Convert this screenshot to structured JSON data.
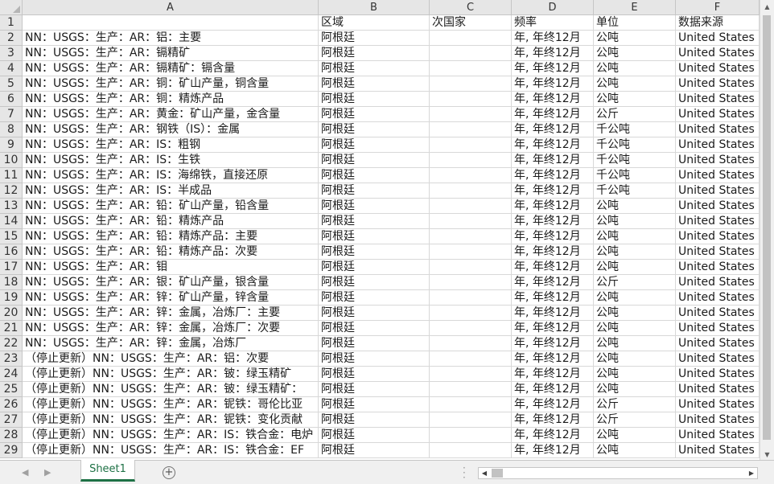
{
  "columns": [
    "A",
    "B",
    "C",
    "D",
    "E",
    "F"
  ],
  "header_row": {
    "num": "1",
    "a": "",
    "b": "区域",
    "c": "次国家",
    "d": "频率",
    "e": "单位",
    "f": "数据来源"
  },
  "rows": [
    {
      "num": "2",
      "a": "NN：USGS：生产：AR：铝：主要",
      "b": "阿根廷",
      "c": "",
      "d": "年, 年终12月",
      "e": "公吨",
      "f": "United States G"
    },
    {
      "num": "3",
      "a": "NN：USGS：生产：AR：镉精矿",
      "b": "阿根廷",
      "c": "",
      "d": "年, 年终12月",
      "e": "公吨",
      "f": "United States G"
    },
    {
      "num": "4",
      "a": "NN：USGS：生产：AR：镉精矿：镉含量",
      "b": "阿根廷",
      "c": "",
      "d": "年, 年终12月",
      "e": "公吨",
      "f": "United States G"
    },
    {
      "num": "5",
      "a": "NN：USGS：生产：AR：铜：矿山产量，铜含量",
      "b": "阿根廷",
      "c": "",
      "d": "年, 年终12月",
      "e": "公吨",
      "f": "United States G"
    },
    {
      "num": "6",
      "a": "NN：USGS：生产：AR：铜：精炼产品",
      "b": "阿根廷",
      "c": "",
      "d": "年, 年终12月",
      "e": "公吨",
      "f": "United States G"
    },
    {
      "num": "7",
      "a": "NN：USGS：生产：AR：黄金：矿山产量，金含量",
      "b": "阿根廷",
      "c": "",
      "d": "年, 年终12月",
      "e": "公斤",
      "f": "United States G"
    },
    {
      "num": "8",
      "a": "NN：USGS：生产：AR：钢铁（IS）：金属",
      "b": "阿根廷",
      "c": "",
      "d": "年, 年终12月",
      "e": "千公吨",
      "f": "United States G"
    },
    {
      "num": "9",
      "a": "NN：USGS：生产：AR：IS：粗钢",
      "b": "阿根廷",
      "c": "",
      "d": "年, 年终12月",
      "e": "千公吨",
      "f": "United States G"
    },
    {
      "num": "10",
      "a": "NN：USGS：生产：AR：IS：生铁",
      "b": "阿根廷",
      "c": "",
      "d": "年, 年终12月",
      "e": "千公吨",
      "f": "United States G"
    },
    {
      "num": "11",
      "a": "NN：USGS：生产：AR：IS：海绵铁，直接还原",
      "b": "阿根廷",
      "c": "",
      "d": "年, 年终12月",
      "e": "千公吨",
      "f": "United States G"
    },
    {
      "num": "12",
      "a": "NN：USGS：生产：AR：IS：半成品",
      "b": "阿根廷",
      "c": "",
      "d": "年, 年终12月",
      "e": "千公吨",
      "f": "United States G"
    },
    {
      "num": "13",
      "a": "NN：USGS：生产：AR：铅：矿山产量，铅含量",
      "b": "阿根廷",
      "c": "",
      "d": "年, 年终12月",
      "e": "公吨",
      "f": "United States G"
    },
    {
      "num": "14",
      "a": "NN：USGS：生产：AR：铅：精炼产品",
      "b": "阿根廷",
      "c": "",
      "d": "年, 年终12月",
      "e": "公吨",
      "f": "United States G"
    },
    {
      "num": "15",
      "a": "NN：USGS：生产：AR：铅：精炼产品：主要",
      "b": "阿根廷",
      "c": "",
      "d": "年, 年终12月",
      "e": "公吨",
      "f": "United States G"
    },
    {
      "num": "16",
      "a": "NN：USGS：生产：AR：铅：精炼产品：次要",
      "b": "阿根廷",
      "c": "",
      "d": "年, 年终12月",
      "e": "公吨",
      "f": "United States G"
    },
    {
      "num": "17",
      "a": "NN：USGS：生产：AR：钼",
      "b": "阿根廷",
      "c": "",
      "d": "年, 年终12月",
      "e": "公吨",
      "f": "United States G"
    },
    {
      "num": "18",
      "a": "NN：USGS：生产：AR：银：矿山产量，银含量",
      "b": "阿根廷",
      "c": "",
      "d": "年, 年终12月",
      "e": "公斤",
      "f": "United States G"
    },
    {
      "num": "19",
      "a": "NN：USGS：生产：AR：锌：矿山产量，锌含量",
      "b": "阿根廷",
      "c": "",
      "d": "年, 年终12月",
      "e": "公吨",
      "f": "United States G"
    },
    {
      "num": "20",
      "a": "NN：USGS：生产：AR：锌：金属，冶炼厂：主要",
      "b": "阿根廷",
      "c": "",
      "d": "年, 年终12月",
      "e": "公吨",
      "f": "United States G"
    },
    {
      "num": "21",
      "a": "NN：USGS：生产：AR：锌：金属，冶炼厂：次要",
      "b": "阿根廷",
      "c": "",
      "d": "年, 年终12月",
      "e": "公吨",
      "f": "United States G"
    },
    {
      "num": "22",
      "a": "NN：USGS：生产：AR：锌：金属，冶炼厂",
      "b": "阿根廷",
      "c": "",
      "d": "年, 年终12月",
      "e": "公吨",
      "f": "United States G"
    },
    {
      "num": "23",
      "a": "（停止更新）NN：USGS：生产：AR：铝：次要",
      "b": "阿根廷",
      "c": "",
      "d": "年, 年终12月",
      "e": "公吨",
      "f": "United States G"
    },
    {
      "num": "24",
      "a": "（停止更新）NN：USGS：生产：AR：铍：绿玉精矿",
      "b": "阿根廷",
      "c": "",
      "d": "年, 年终12月",
      "e": "公吨",
      "f": "United States G"
    },
    {
      "num": "25",
      "a": "（停止更新）NN：USGS：生产：AR：铍：绿玉精矿：",
      "b": "阿根廷",
      "c": "",
      "d": "年, 年终12月",
      "e": "公吨",
      "f": "United States G"
    },
    {
      "num": "26",
      "a": "（停止更新）NN：USGS：生产：AR：铌铁：哥伦比亚",
      "b": "阿根廷",
      "c": "",
      "d": "年, 年终12月",
      "e": "公斤",
      "f": "United States G"
    },
    {
      "num": "27",
      "a": "（停止更新）NN：USGS：生产：AR：铌铁：变化贡献",
      "b": "阿根廷",
      "c": "",
      "d": "年, 年终12月",
      "e": "公斤",
      "f": "United States G"
    },
    {
      "num": "28",
      "a": "（停止更新）NN：USGS：生产：AR：IS：铁合金：电炉",
      "b": "阿根廷",
      "c": "",
      "d": "年, 年终12月",
      "e": "公吨",
      "f": "United States G"
    },
    {
      "num": "29",
      "a": "（停止更新）NN：USGS：生产：AR：IS：铁合金：EF",
      "b": "阿根廷",
      "c": "",
      "d": "年, 年终12月",
      "e": "公吨",
      "f": "United States G"
    }
  ],
  "sheet_tab": "Sheet1",
  "add_sheet": "+",
  "accent_color": "#1e7145"
}
